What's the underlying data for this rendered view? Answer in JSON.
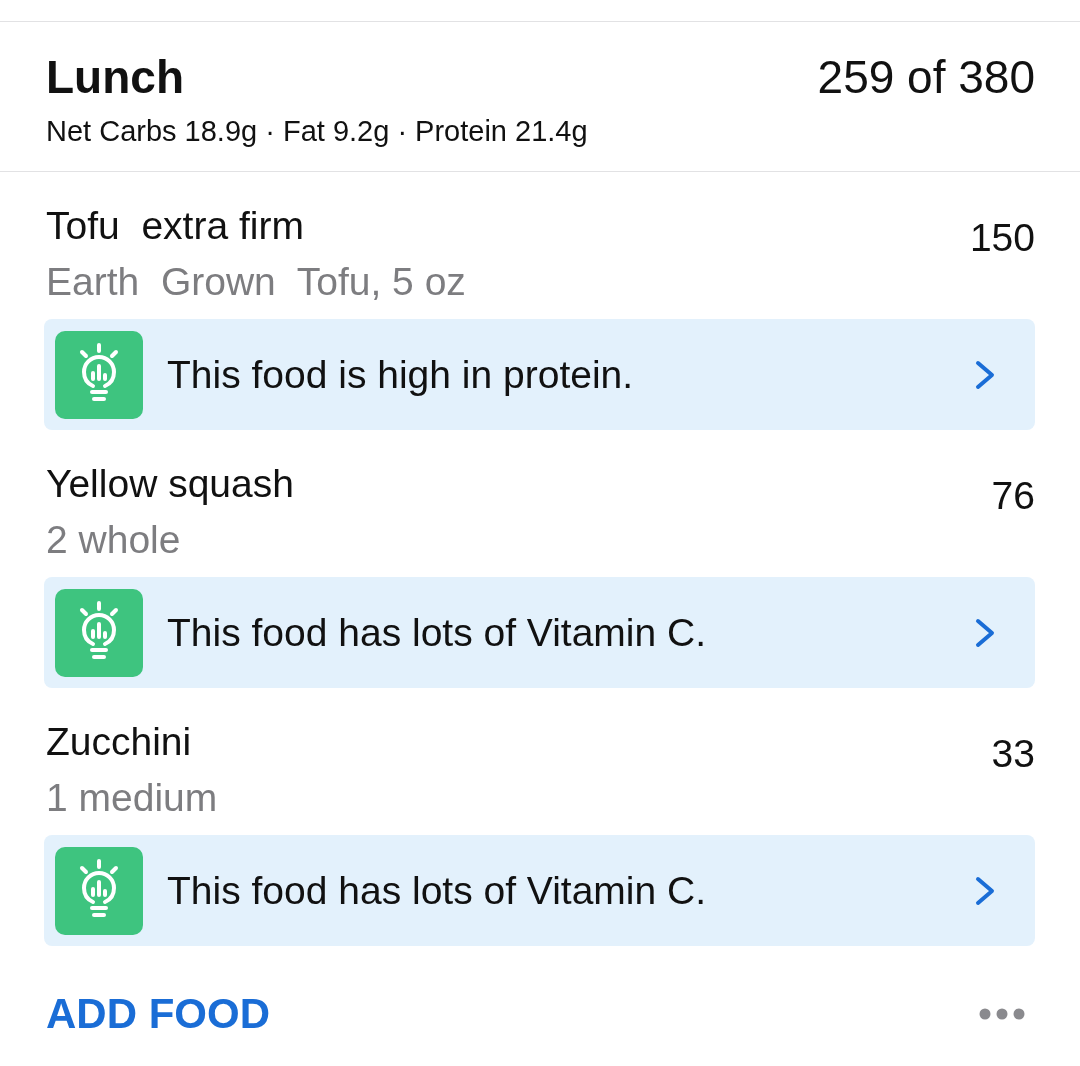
{
  "meal": {
    "title": "Lunch",
    "calories": "259 of 380",
    "macros": "Net Carbs 18.9g · Fat 9.2g · Protein 21.4g"
  },
  "foods": [
    {
      "name": "Tofu  extra firm",
      "serving": "Earth  Grown  Tofu, 5 oz",
      "calories": "150",
      "tip": "This food is high in protein."
    },
    {
      "name": "Yellow squash",
      "serving": "2 whole",
      "calories": "76",
      "tip": "This food has lots of Vitamin C."
    },
    {
      "name": "Zucchini",
      "serving": "1 medium",
      "calories": "33",
      "tip": "This food has lots of Vitamin C."
    }
  ],
  "footer": {
    "add_button": "ADD FOOD"
  }
}
